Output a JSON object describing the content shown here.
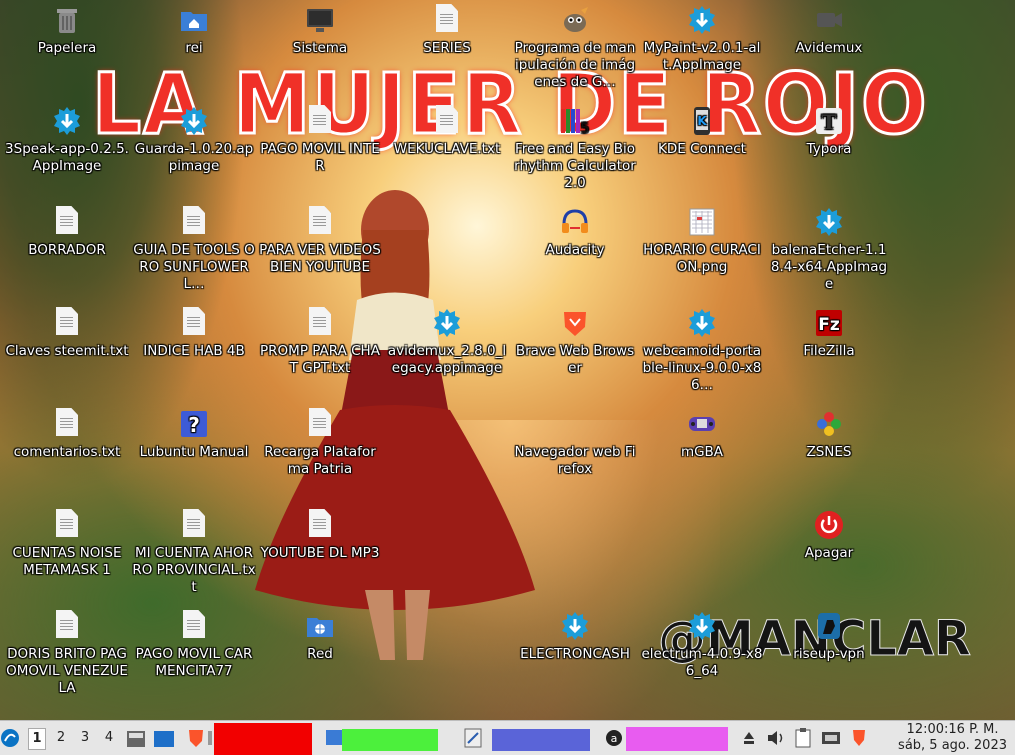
{
  "wallpaper": {
    "banner_text": "LA MUJER DE ROJO",
    "logo_text": "@MANCLAR"
  },
  "desktop_icons": [
    {
      "label": "Papelera",
      "icon": "trash-icon"
    },
    {
      "label": "rei",
      "icon": "home-folder-icon"
    },
    {
      "label": "Sistema",
      "icon": "computer-icon"
    },
    {
      "label": "SERIES",
      "icon": "text-file-icon"
    },
    {
      "label": "Programa de manipulación de imágenes de G…",
      "icon": "gimp-icon"
    },
    {
      "label": "MyPaint-v2.0.1-alt.AppImage",
      "icon": "appimage-icon"
    },
    {
      "label": "Avidemux",
      "icon": "video-icon"
    },
    {
      "label": "3Speak-app-0.2.5.AppImage",
      "icon": "appimage-icon"
    },
    {
      "label": "Guarda-1.0.20.appimage",
      "icon": "appimage-icon"
    },
    {
      "label": "PAGO MOVIL INTER",
      "icon": "text-file-icon"
    },
    {
      "label": "WEKUCLAVE.txt",
      "icon": "text-file-icon"
    },
    {
      "label": "Free and Easy Biorhythm Calculator 2.0",
      "icon": "biorhythm-icon"
    },
    {
      "label": "KDE Connect",
      "icon": "kde-connect-icon"
    },
    {
      "label": "Typora",
      "icon": "typora-icon"
    },
    {
      "label": "BORRADOR",
      "icon": "text-file-icon"
    },
    {
      "label": "GUIA DE TOOLS ORO SUNFLOWERL…",
      "icon": "text-file-icon"
    },
    {
      "label": "PARA VER VIDEOS BIEN YOUTUBE",
      "icon": "text-file-icon"
    },
    {
      "label": "Audacity",
      "icon": "audacity-icon"
    },
    {
      "label": "HORARIO CURACION.png",
      "icon": "image-file-icon"
    },
    {
      "label": "balenaEtcher-1.18.4-x64.AppImage",
      "icon": "appimage-icon"
    },
    {
      "label": "Claves steemit.txt",
      "icon": "text-file-icon"
    },
    {
      "label": "INDICE HAB 4B",
      "icon": "text-file-icon"
    },
    {
      "label": "PROMP PARA CHAT GPT.txt",
      "icon": "text-file-icon"
    },
    {
      "label": "avidemux_2.8.0_legacy.appimage",
      "icon": "appimage-icon"
    },
    {
      "label": "Brave Web Browser",
      "icon": "brave-icon"
    },
    {
      "label": "webcamoid-portable-linux-9.0.0-x86…",
      "icon": "appimage-icon"
    },
    {
      "label": "FileZilla",
      "icon": "filezilla-icon"
    },
    {
      "label": "comentarios.txt",
      "icon": "text-file-icon"
    },
    {
      "label": "Lubuntu Manual",
      "icon": "help-icon"
    },
    {
      "label": "Recarga Plataforma Patria",
      "icon": "text-file-icon"
    },
    {
      "label": "Navegador web Firefox",
      "icon": "firefox-icon"
    },
    {
      "label": "mGBA",
      "icon": "mgba-icon"
    },
    {
      "label": "ZSNES",
      "icon": "zsnes-icon"
    },
    {
      "label": "CUENTAS NOISE METAMASK 1",
      "icon": "text-file-icon"
    },
    {
      "label": "MI CUENTA AHORRO PROVINCIAL.txt",
      "icon": "text-file-icon"
    },
    {
      "label": "YOUTUBE DL MP3",
      "icon": "text-file-icon"
    },
    {
      "label": "Apagar",
      "icon": "power-icon"
    },
    {
      "label": "DORIS BRITO PAGOMOVIL VENEZUELA",
      "icon": "text-file-icon"
    },
    {
      "label": "PAGO MOVIL CARMENCITA77",
      "icon": "text-file-icon"
    },
    {
      "label": "Red",
      "icon": "network-folder-icon"
    },
    {
      "label": "ELECTRONCASH",
      "icon": "appimage-icon"
    },
    {
      "label": "electrum-4.0.9-x86_64",
      "icon": "appimage-icon"
    },
    {
      "label": "riseup-vpn",
      "icon": "riseup-icon"
    }
  ],
  "taskbar": {
    "workspaces": [
      "1",
      "2",
      "3",
      "4"
    ],
    "clock_time": "12:00:16 P. M.",
    "clock_date": "sáb, 5 ago. 2023"
  }
}
